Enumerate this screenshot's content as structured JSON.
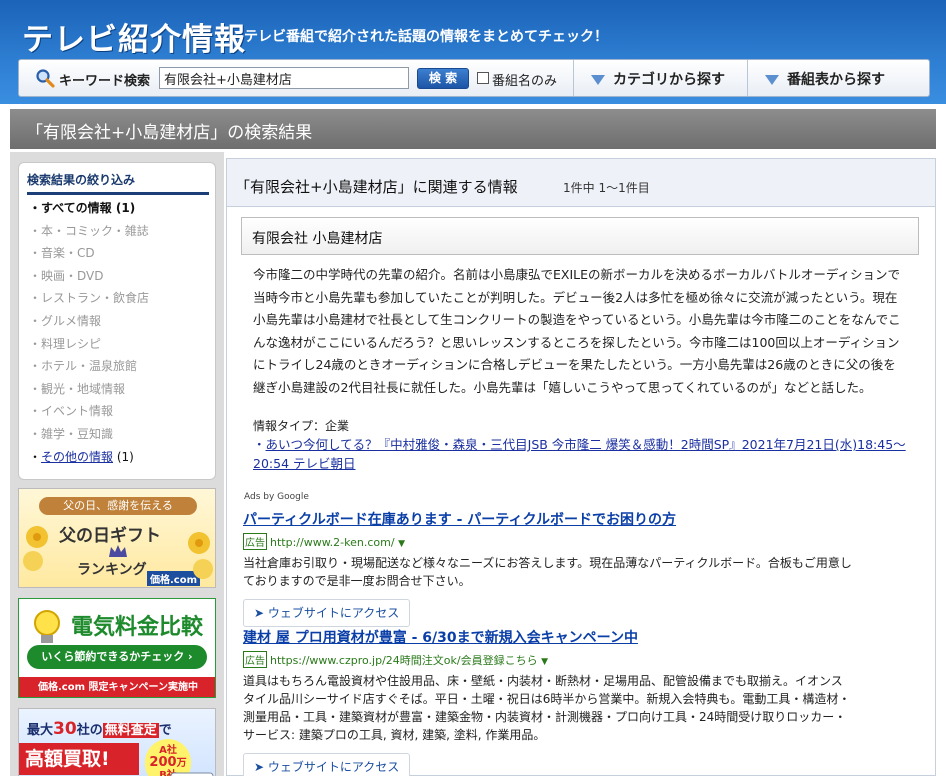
{
  "header": {
    "logo": "テレビ紹介情報",
    "tagline": "テレビ番組で紹介された話題の情報をまとめてチェック！"
  },
  "search": {
    "label": "キーワード検索",
    "value": "有限会社+小島建材店",
    "button": "検 索",
    "checkbox_label": "番組名のみ",
    "category_button": "カテゴリから探す",
    "program_button": "番組表から探す"
  },
  "page_title": "「有限会社+小島建材店」の検索結果",
  "sidebar": {
    "title": "検索結果の絞り込み",
    "items": [
      {
        "label": "・すべての情報 (1)"
      },
      {
        "label": "・本・コミック・雑誌"
      },
      {
        "label": "・音楽・CD"
      },
      {
        "label": "・映画・DVD"
      },
      {
        "label": "・レストラン・飲食店"
      },
      {
        "label": "・グルメ情報"
      },
      {
        "label": "・料理レシピ"
      },
      {
        "label": "・ホテル・温泉旅館"
      },
      {
        "label": "・観光・地域情報"
      },
      {
        "label": "・イベント情報"
      },
      {
        "label": "・雑学・豆知識"
      }
    ],
    "other_prefix": "・",
    "other_link": "その他の情報",
    "other_count": "(1)"
  },
  "banners": {
    "b1_top": "父の日、感謝を伝える",
    "b1_main": "父の日ギフト",
    "b1_sub": "ランキング",
    "b1_brand": "価格.com",
    "b2_main": "電気料金比較",
    "b2_sub": "いくら節約できるかチェック",
    "b2_foot": "価格.com 限定キャンペーン実施中",
    "b3_line1a": "最大",
    "b3_line1b": "30",
    "b3_line1c": "社の",
    "b3_line1d": "無料査定",
    "b3_line1e": "で",
    "b3_line2": "高額買取!",
    "b3_badge_a": "A社",
    "b3_badge_b": "200",
    "b3_badge_c": "万",
    "b3_badge_d": "B社"
  },
  "main": {
    "heading": "「有限会社+小島建材店」に関連する情報",
    "count": "1件中 1〜1件目",
    "entry_title": "有限会社 小島建材店",
    "description": "今市隆二の中学時代の先輩の紹介。名前は小島康弘でEXILEの新ボーカルを決めるボーカルバトルオーディションで当時今市と小島先輩も参加していたことが判明した。デビュー後2人は多忙を極め徐々に交流が減ったという。現在小島先輩は小島建材で社長として生コンクリートの製造をやっているという。小島先輩は今市隆二のことをなんでこんな逸材がここにいるんだろう？と思いレッスンするところを探したという。今市隆二は100回以上オーディションにトライし24歳のときオーディションに合格しデビューを果たしたという。一方小島先輩は26歳のときに父の後を継ぎ小島建設の2代目社長に就任した。小島先輩は「嬉しいこうやって思ってくれているのが」などと話した。",
    "info_type": "情報タイプ：企業",
    "related_prefix": "・",
    "related_link": "あいつ今何してる？『中村雅俊・森泉・三代目JSB 今市隆二 爆笑＆感動！2時間SP』2021年7月21日(水)18:45〜20:54 テレビ朝日"
  },
  "ads": {
    "label": "Ads by Google",
    "badge": "広告",
    "visit": "ウェブサイトにアクセス",
    "items": [
      {
        "title": "パーティクルボード在庫あります - パーティクルボードでお困りの方",
        "url": "http://www.2-ken.com/",
        "desc": "当社倉庫お引取り・現場配送など様々なニーズにお答えします。現在品薄なパーティクルボード。合板もご用意しておりますので是非一度お問合せ下さい。"
      },
      {
        "title": "建材 屋 プロ用資材が豊富 - 6/30まで新規入会キャンペーン中",
        "url": "https://www.czpro.jp/24時間注文ok/会員登録こちら",
        "desc": "道具はもちろん電設資材や住設用品、床・壁紙・内装材・断熱材・足場用品、配管設備までも取揃え。イオンスタイル品川シーサイド店すぐそば。平日・土曜・祝日は6時半から営業中。新規入会特典も。電動工具・構造材・測量用品・工具・建築資材が豊富・建築金物・内装資材・計測機器・プロ向け工具・24時間受け取りロッカー・サービス: 建築プロの工具, 資材, 建築, 塗料, 作業用品。"
      }
    ]
  }
}
